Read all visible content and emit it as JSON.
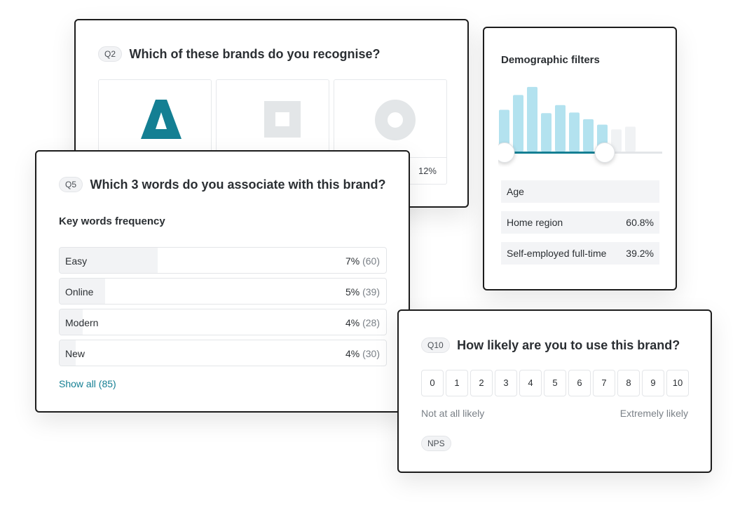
{
  "q2": {
    "tag": "Q2",
    "question": "Which of these brands do you recognise?",
    "brands": [
      {
        "logo": "triangle-a-logo",
        "percent": ""
      },
      {
        "logo": "square-logo",
        "percent": ""
      },
      {
        "logo": "ring-logo",
        "percent": "12%"
      }
    ],
    "colors": {
      "brand_teal": "#147f93",
      "logo_grey": "#e3e6e8"
    }
  },
  "q5": {
    "tag": "Q5",
    "question": "Which 3 words do you associate with this brand?",
    "section_title": "Key words frequency",
    "keywords": [
      {
        "label": "Easy",
        "percent": "7%",
        "count": "(60)",
        "share": 0.3
      },
      {
        "label": "Online",
        "percent": "5%",
        "count": "(39)",
        "share": 0.14
      },
      {
        "label": "Modern",
        "percent": "4%",
        "count": "(28)",
        "share": 0.07
      },
      {
        "label": "New",
        "percent": "4%",
        "count": "(30)",
        "share": 0.05
      }
    ],
    "show_all": "Show all (85)"
  },
  "demographics": {
    "title": "Demographic filters",
    "histogram": {
      "values": [
        0.62,
        0.84,
        0.96,
        0.57,
        0.69,
        0.58,
        0.48,
        0.4,
        0.33,
        0.37
      ],
      "selected_range": [
        0,
        7
      ],
      "colors": {
        "active": "#b3e2ef",
        "inactive": "#f0f2f4",
        "track": "#e3e5e8",
        "track_active": "#147f93"
      }
    },
    "filters": [
      {
        "label": "Age",
        "value": ""
      },
      {
        "label": "Home region",
        "value": "60.8%"
      },
      {
        "label": "Self-employed full-time",
        "value": "39.2%"
      }
    ]
  },
  "q10": {
    "tag": "Q10",
    "question": "How likely are you to use this brand?",
    "scale": [
      "0",
      "1",
      "2",
      "3",
      "4",
      "5",
      "6",
      "7",
      "8",
      "9",
      "10"
    ],
    "low_label": "Not at all likely",
    "high_label": "Extremely likely",
    "badge": "NPS"
  }
}
